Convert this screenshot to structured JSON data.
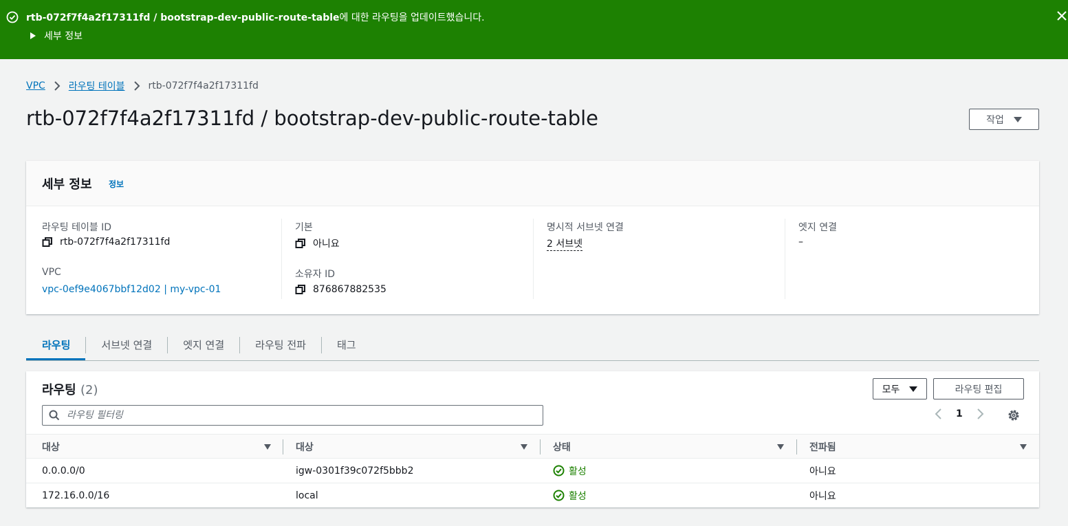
{
  "flash": {
    "message_bold": "rtb-072f7f4a2f17311fd / bootstrap-dev-public-route-table",
    "message_rest": "에 대한 라우팅을 업데이트했습니다.",
    "details_label": "세부 정보",
    "color": "#1d8102"
  },
  "breadcrumb": {
    "items": [
      "VPC",
      "라우팅 테이블"
    ],
    "current": "rtb-072f7f4a2f17311fd"
  },
  "page": {
    "title": "rtb-072f7f4a2f17311fd / bootstrap-dev-public-route-table",
    "actions_label": "작업"
  },
  "details": {
    "title": "세부 정보",
    "info_link": "정보",
    "route_table_id_label": "라우팅 테이블 ID",
    "route_table_id": "rtb-072f7f4a2f17311fd",
    "vpc_label": "VPC",
    "vpc_value": "vpc-0ef9e4067bbf12d02 | my-vpc-01",
    "main_label": "기본",
    "main_value": "아니요",
    "owner_label": "소유자 ID",
    "owner_value": "876867882535",
    "subnet_assoc_label": "명시적 서브넷 연결",
    "subnet_assoc_value": "2 서브넷",
    "edge_assoc_label": "엣지 연결",
    "edge_assoc_value": "–"
  },
  "tabs": [
    {
      "label": "라우팅",
      "active": true
    },
    {
      "label": "서브넷 연결",
      "active": false
    },
    {
      "label": "엣지 연결",
      "active": false
    },
    {
      "label": "라우팅 전파",
      "active": false
    },
    {
      "label": "태그",
      "active": false
    }
  ],
  "routes": {
    "title": "라우팅",
    "count": "(2)",
    "filter_select": "모두",
    "edit_button": "라우팅 편집",
    "search_placeholder": "라우팅 필터링",
    "page_number": "1",
    "columns": [
      "대상",
      "대상",
      "상태",
      "전파됨"
    ],
    "rows": [
      {
        "destination": "0.0.0.0/0",
        "target": "igw-0301f39c072f5bbb2",
        "target_is_link": true,
        "status": "활성",
        "propagated": "아니요"
      },
      {
        "destination": "172.16.0.0/16",
        "target": "local",
        "target_is_link": false,
        "status": "활성",
        "propagated": "아니요"
      }
    ]
  },
  "colors": {
    "link": "#0073bb",
    "success": "#1d8102",
    "background": "#f2f3f3"
  }
}
